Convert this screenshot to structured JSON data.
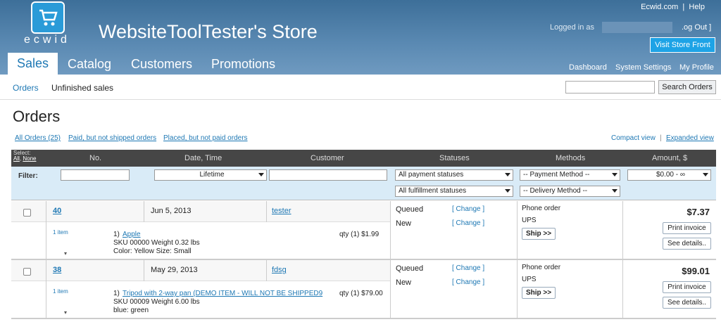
{
  "brand": {
    "logo_text": "ecwid",
    "store_title": "WebsiteToolTester's Store"
  },
  "top": {
    "ecwid_link": "Ecwid.com",
    "sep": "|",
    "help_link": "Help",
    "logged_in": "Logged in as",
    "logout": ".og Out ]",
    "visit": "Visit Store Front"
  },
  "tabs": [
    "Sales",
    "Catalog",
    "Customers",
    "Promotions"
  ],
  "right_links": [
    "Dashboard",
    "System Settings",
    "My Profile"
  ],
  "subnav": {
    "orders": "Orders",
    "unfinished": "Unfinished sales",
    "search_btn": "Search Orders"
  },
  "page_title": "Orders",
  "filter_links": [
    "All Orders (25)",
    "Paid, but not shipped orders",
    "Placed, but not paid orders"
  ],
  "views": {
    "compact": "Compact view",
    "sep": "|",
    "expanded": "Expanded view"
  },
  "columns": {
    "select": "Select:",
    "all": "All",
    "none": "None",
    "no": "No.",
    "date": "Date, Time",
    "customer": "Customer",
    "statuses": "Statuses",
    "methods": "Methods",
    "amount": "Amount, $"
  },
  "filters": {
    "label": "Filter:",
    "lifetime": "Lifetime",
    "payment_statuses": "All payment statuses",
    "fulfillment_statuses": "All fulfillment statuses",
    "payment_method": "-- Payment Method --",
    "delivery_method": "-- Delivery Method --",
    "amount": "$0.00 - ∞"
  },
  "orders": [
    {
      "no": "40",
      "date": "Jun 5, 2013",
      "customer": "tester",
      "items_count": "1 item",
      "line_no": "1)",
      "item_name": "Apple",
      "sku_line": "SKU 00000 Weight  0.32 lbs",
      "options": "Color: Yellow Size: Small",
      "qty": "qty (1)  $1.99",
      "pay_status": "Queued",
      "ful_status": "New",
      "change": "[ Change ]",
      "pay_method": "Phone order",
      "ship_method": "UPS",
      "ship_btn": "Ship >>",
      "amount": "$7.37",
      "print_btn": "Print invoice",
      "details_btn": "See details.."
    },
    {
      "no": "38",
      "date": "May 29, 2013",
      "customer": "fdsg",
      "items_count": "1 item",
      "line_no": "1)",
      "item_name": "Tripod with 2-way pan (DEMO ITEM - WILL NOT BE SHIPPED9",
      "sku_line": "SKU 00009 Weight  6.00 lbs",
      "options": "blue:  green",
      "qty": "qty (1)  $79.00",
      "pay_status": "Queued",
      "ful_status": "New",
      "change": "[ Change ]",
      "pay_method": "Phone order",
      "ship_method": "UPS",
      "ship_btn": "Ship >>",
      "amount": "$99.01",
      "print_btn": "Print invoice",
      "details_btn": "See details.."
    }
  ]
}
